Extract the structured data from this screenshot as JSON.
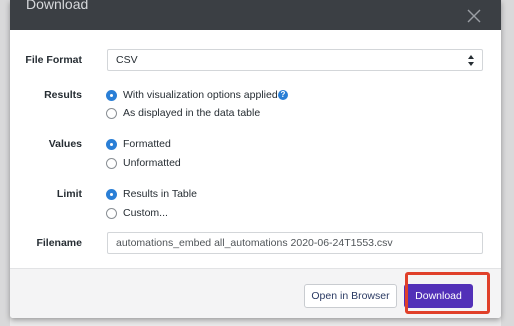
{
  "modal": {
    "title": "Download"
  },
  "form": {
    "file_format": {
      "label": "File Format",
      "value": "CSV"
    },
    "results": {
      "label": "Results",
      "options": [
        {
          "label": "With visualization options applied",
          "checked": true
        },
        {
          "label": "As displayed in the data table",
          "checked": false
        }
      ],
      "help_icon": "?"
    },
    "values": {
      "label": "Values",
      "options": [
        {
          "label": "Formatted",
          "checked": true
        },
        {
          "label": "Unformatted",
          "checked": false
        }
      ]
    },
    "limit": {
      "label": "Limit",
      "options": [
        {
          "label": "Results in Table",
          "checked": true
        },
        {
          "label": "Custom...",
          "checked": false
        }
      ]
    },
    "filename": {
      "label": "Filename",
      "value": "automations_embed all_automations 2020-06-24T1553.csv"
    }
  },
  "footer": {
    "open_label": "Open in Browser",
    "download_label": "Download"
  },
  "colors": {
    "header_bg": "#3b3f44",
    "radio_checked": "#2a7fd6",
    "primary_button": "#5230b8",
    "highlight_border": "#e0402a"
  },
  "icons": {
    "close": "close-icon",
    "select_caret": "select-caret-icon",
    "help": "help-icon"
  }
}
